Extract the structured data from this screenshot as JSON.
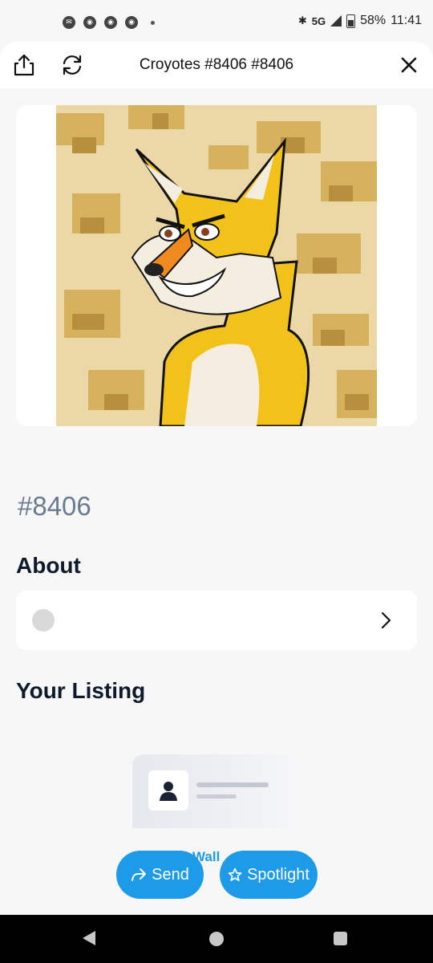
{
  "status_bar": {
    "time": "11:41",
    "battery": "58%",
    "network": "5G",
    "notification_icons": [
      "messenger-icon",
      "discord-icon",
      "discord-icon",
      "discord-icon"
    ]
  },
  "header": {
    "title": "Croyotes #8406 #8406",
    "share_icon": "share-icon",
    "refresh_icon": "refresh-icon",
    "close_icon": "close-icon"
  },
  "nft": {
    "token_id": "#8406"
  },
  "about": {
    "heading": "About"
  },
  "listing": {
    "heading": "Your Listing",
    "partial_text": "Wall"
  },
  "actions": {
    "send_label": "Send",
    "spotlight_label": "Spotlight"
  },
  "colors": {
    "accent": "#1e9be8",
    "background": "#f7f7f8",
    "token_id": "#6b7a93",
    "heading": "#0f1b2d"
  }
}
